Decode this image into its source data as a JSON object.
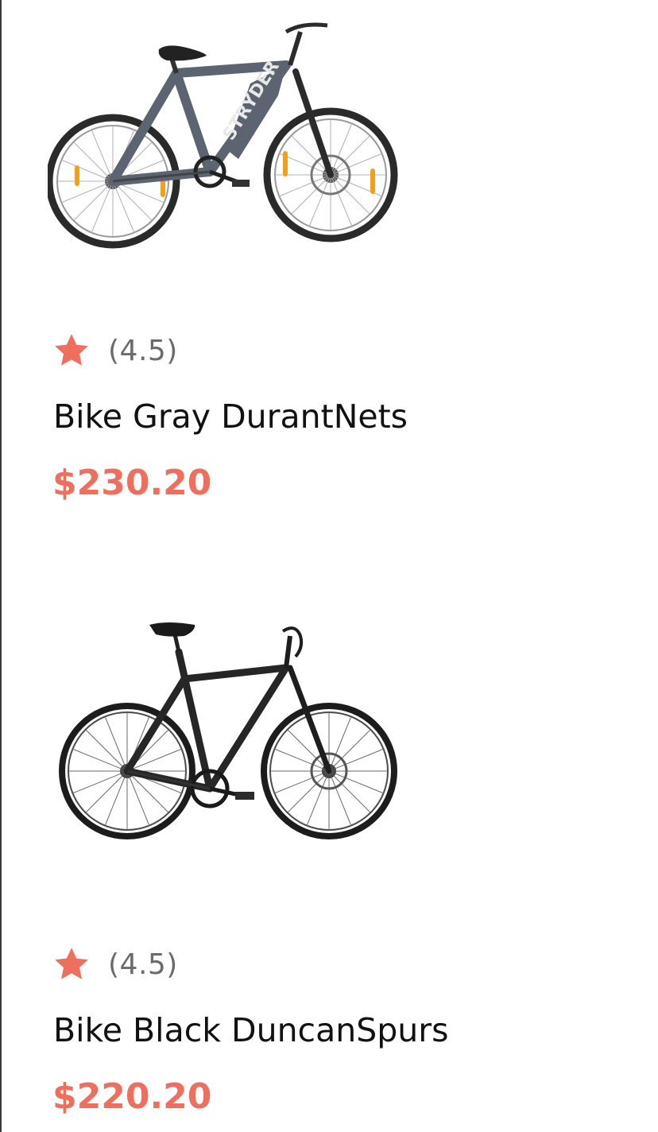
{
  "theme": {
    "accent": "#ee6f5e",
    "text": "#111111",
    "muted": "#6b6b6b"
  },
  "products": [
    {
      "image_icon": "bike-gray-image",
      "rating": "(4.5)",
      "name": "Bike Gray DurantNets",
      "price": "$230.20",
      "frame_color": "#5b6470",
      "frame_text": "STRYDER"
    },
    {
      "image_icon": "bike-black-image",
      "rating": "(4.5)",
      "name": "Bike Black DuncanSpurs",
      "price": "$220.20",
      "frame_color": "#222222"
    }
  ]
}
